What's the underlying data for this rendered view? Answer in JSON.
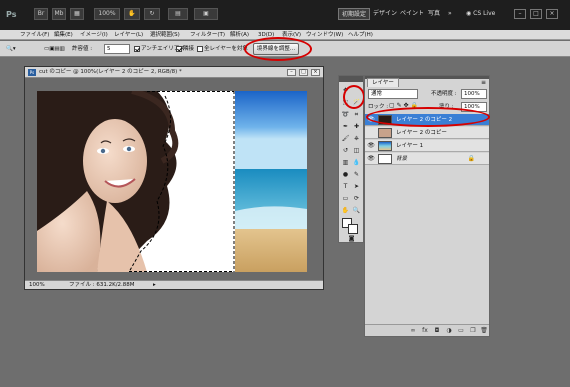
{
  "appbar": {
    "logo": "Ps",
    "zoom": "100%",
    "workspaces": [
      "初期設定",
      "デザイン",
      "ペイント",
      "写真"
    ],
    "more": "»",
    "cs_live": "CS Live",
    "win_min": "–",
    "win_max": "□",
    "win_close": "×"
  },
  "menu": [
    {
      "label": "ファイル(F)"
    },
    {
      "label": "編集(E)"
    },
    {
      "label": "イメージ(I)"
    },
    {
      "label": "レイヤー(L)"
    },
    {
      "label": "選択範囲(S)"
    },
    {
      "label": "フィルター(T)"
    },
    {
      "label": "解析(A)"
    },
    {
      "label": "3D(D)"
    },
    {
      "label": "表示(V)"
    },
    {
      "label": "ウィンドウ(W)"
    },
    {
      "label": "ヘルプ(H)"
    }
  ],
  "options": {
    "tolerance_label": "許容値 :",
    "tolerance_value": "5",
    "antialias": "アンチエイリアス",
    "contiguous": "隣接",
    "all_layers": "全レイヤーを対象",
    "refine_edge": "境界線を調整..."
  },
  "document": {
    "title": "cut のコピー @ 100%(レイヤー 2 のコピー 2, RGB/8) *",
    "zoom": "100%",
    "file_info": "ファイル : 631.2K/2.88M"
  },
  "layers": {
    "tab": "レイヤー",
    "blend_mode": "通常",
    "opacity_label": "不透明度 :",
    "opacity_value": "100%",
    "lock_label": "ロック :",
    "fill_label": "塗り :",
    "fill_value": "100%",
    "rows": [
      {
        "name": "レイヤー 2 のコピー 2",
        "selected": true
      },
      {
        "name": "レイヤー 2 のコピー",
        "selected": false
      },
      {
        "name": "レイヤー 1",
        "selected": false
      },
      {
        "name": "背景",
        "selected": false
      }
    ]
  },
  "colors": {
    "accent": "#3a7fd5",
    "highlight": "#d60000"
  }
}
